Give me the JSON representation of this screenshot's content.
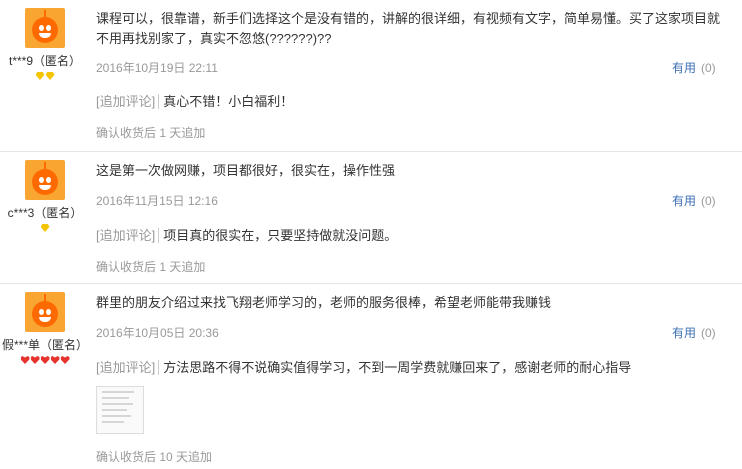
{
  "reviews": [
    {
      "user": "t***9（匿名）",
      "badge_type": "diamond",
      "badge_count": 2,
      "text": "课程可以，很靠谱，新手们选择这个是没有错的，讲解的很详细，有视频有文字，简单易懂。买了这家项目就不用再找别家了，真实不忽悠(??????)??",
      "date": "2016年10月19日 22:11",
      "useful_label": "有用",
      "useful_count": "(0)",
      "followup_tag": "[追加评论]",
      "followup_text": "真心不错！小白福利！",
      "followup_time": "确认收货后 1 天追加"
    },
    {
      "user": "c***3（匿名）",
      "badge_type": "diamond",
      "badge_count": 1,
      "text": "这是第一次做网赚，项目都很好，很实在，操作性强",
      "date": "2016年11月15日 12:16",
      "useful_label": "有用",
      "useful_count": "(0)",
      "followup_tag": "[追加评论]",
      "followup_text": "项目真的很实在，只要坚持做就没问题。",
      "followup_time": "确认收货后 1 天追加"
    },
    {
      "user": "假***单（匿名）",
      "badge_type": "heart",
      "badge_count": 5,
      "text": "群里的朋友介绍过来找飞翔老师学习的，老师的服务很棒，希望老师能带我赚钱",
      "date": "2016年10月05日 20:36",
      "useful_label": "有用",
      "useful_count": "(0)",
      "followup_tag": "[追加评论]",
      "followup_text": "方法思路不得不说确实值得学习，不到一周学费就赚回来了，感谢老师的耐心指导",
      "followup_time": "确认收货后 10 天追加"
    }
  ]
}
